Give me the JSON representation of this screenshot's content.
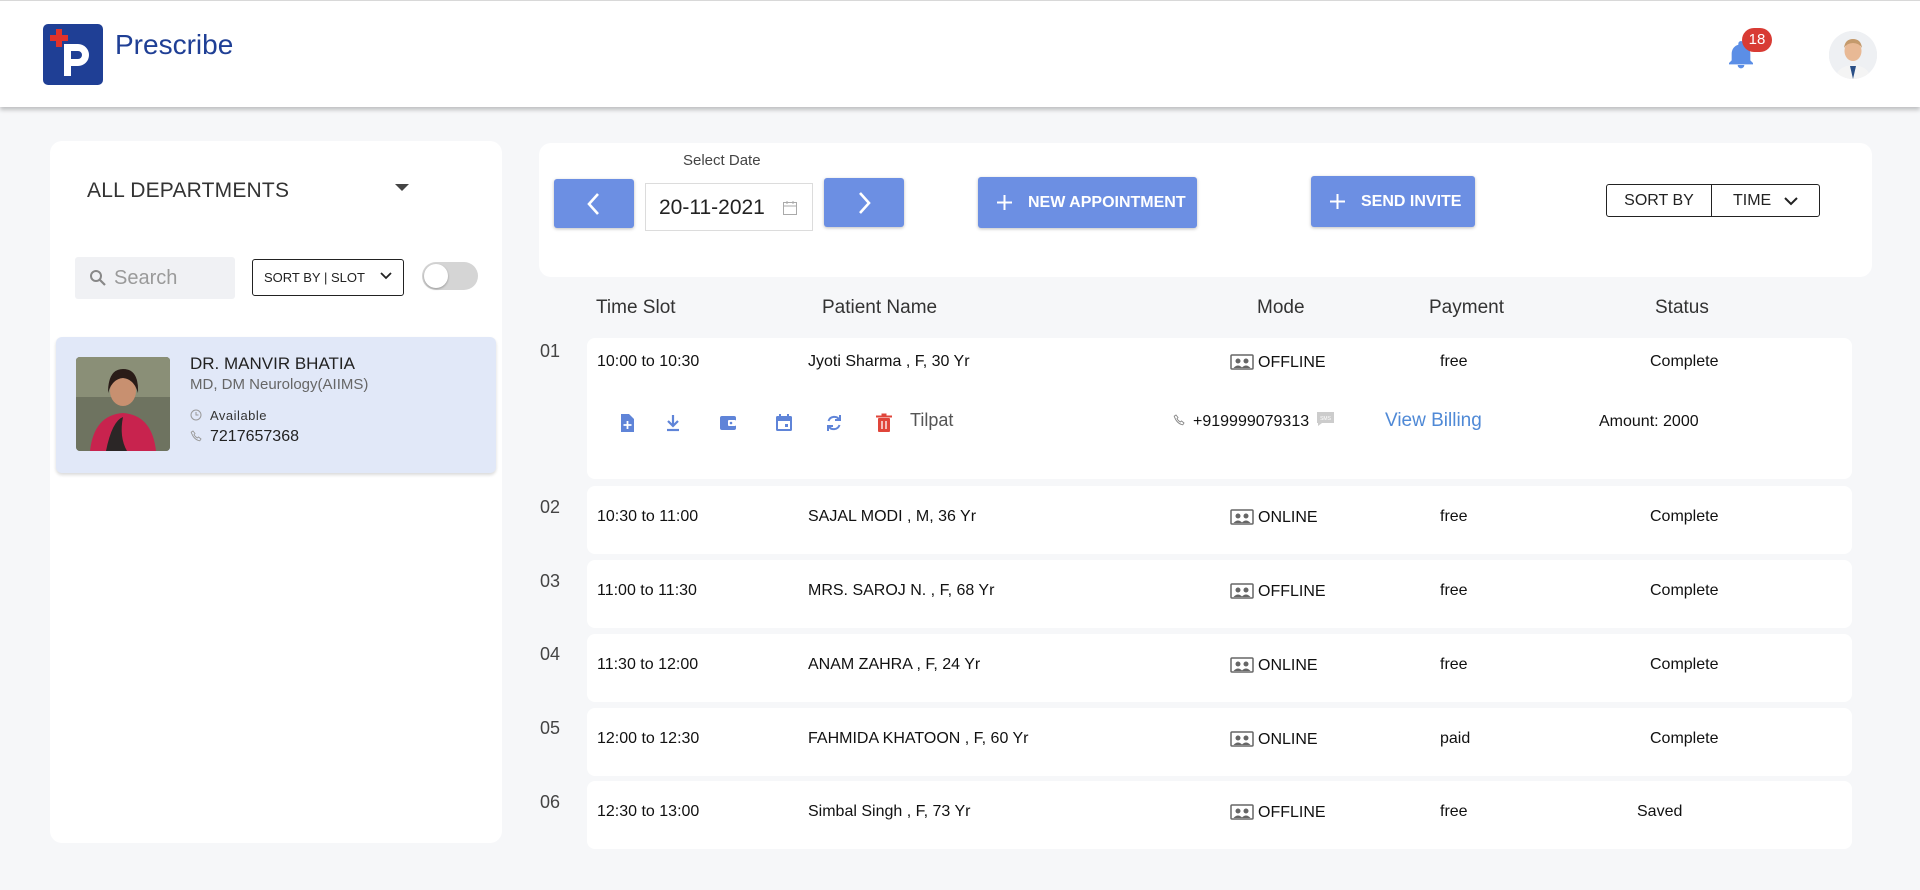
{
  "app": {
    "name": "Prescribe",
    "notification_count": "18"
  },
  "left_panel": {
    "department": "ALL DEPARTMENTS",
    "search_placeholder": "Search",
    "sort_label": "SORT BY | SLOT",
    "doctor": {
      "name": "DR. MANVIR BHATIA",
      "qualification": "MD, DM Neurology(AIIMS)",
      "status": "Available",
      "phone": "7217657368"
    }
  },
  "toolbar": {
    "date_label": "Select Date",
    "date_value": "20-11-2021",
    "new_appointment": "NEW APPOINTMENT",
    "send_invite": "SEND INVITE",
    "sort_by": "SORT BY",
    "sort_value": "TIME"
  },
  "table": {
    "headers": [
      "Time Slot",
      "Patient Name",
      "Mode",
      "Payment",
      "Status"
    ],
    "rows": [
      {
        "num": "01",
        "slot": "10:00 to 10:30",
        "patient": "Jyoti Sharma , F, 30 Yr",
        "mode": "OFFLINE",
        "payment": "free",
        "status": "Complete"
      },
      {
        "num": "02",
        "slot": "10:30 to 11:00",
        "patient": "SAJAL MODI , M, 36 Yr",
        "mode": "ONLINE",
        "payment": "free",
        "status": "Complete"
      },
      {
        "num": "03",
        "slot": "11:00 to 11:30",
        "patient": "MRS. SAROJ N. , F, 68 Yr",
        "mode": "OFFLINE",
        "payment": "free",
        "status": "Complete"
      },
      {
        "num": "04",
        "slot": "11:30 to 12:00",
        "patient": "ANAM ZAHRA , F, 24 Yr",
        "mode": "ONLINE",
        "payment": "free",
        "status": "Complete"
      },
      {
        "num": "05",
        "slot": "12:00 to 12:30",
        "patient": "FAHMIDA KHATOON , F, 60 Yr",
        "mode": "ONLINE",
        "payment": "paid",
        "status": "Complete"
      },
      {
        "num": "06",
        "slot": "12:30 to 13:00",
        "patient": "Simbal Singh , F, 73 Yr",
        "mode": "OFFLINE",
        "payment": "free",
        "status": "Saved"
      }
    ],
    "expanded": {
      "location": "Tilpat",
      "phone": "+919999079313",
      "billing_link": "View Billing",
      "amount": "Amount: 2000"
    }
  },
  "colors": {
    "brand": "#1f3f95",
    "button": "#6c8fe3",
    "selected_card": "#e1e8f8",
    "badge": "#d83b34",
    "delete": "#e0453a",
    "link": "#4f89d6"
  }
}
